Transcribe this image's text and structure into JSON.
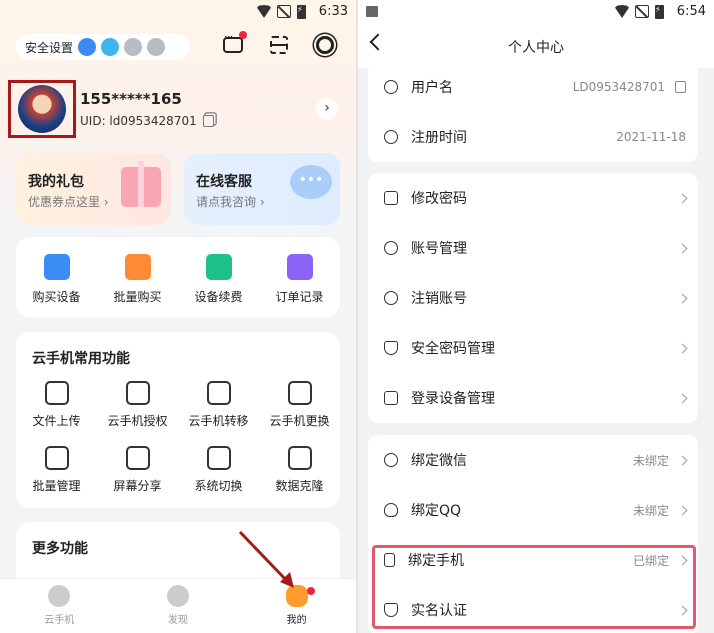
{
  "left": {
    "status": {
      "time": "6:33"
    },
    "security": {
      "label": "安全设置"
    },
    "user": {
      "phone": "155*****165",
      "uid": "UID: ld0953428701"
    },
    "cards": [
      {
        "title": "我的礼包",
        "sub": "优惠券点这里 ›"
      },
      {
        "title": "在线客服",
        "sub": "请点我咨询 ›"
      }
    ],
    "quick": [
      {
        "label": "购买设备",
        "color": "#3c8cf5"
      },
      {
        "label": "批量购买",
        "color": "#ff8a34"
      },
      {
        "label": "设备续费",
        "color": "#1ec18a"
      },
      {
        "label": "订单记录",
        "color": "#8b64f5"
      }
    ],
    "common": {
      "title": "云手机常用功能",
      "items": [
        "文件上传",
        "云手机授权",
        "云手机转移",
        "云手机更换",
        "批量管理",
        "屏幕分享",
        "系统切换",
        "数据克隆"
      ]
    },
    "more": {
      "title": "更多功能"
    },
    "nav": [
      {
        "label": "云手机",
        "icon": "cloud-phone-icon"
      },
      {
        "label": "发现",
        "icon": "discover-icon"
      },
      {
        "label": "我的",
        "icon": "mine-icon"
      }
    ]
  },
  "right": {
    "status": {
      "time": "6:54"
    },
    "title": "个人中心",
    "group1": [
      {
        "label": "用户名",
        "value": "LD0953428701"
      },
      {
        "label": "注册时间",
        "value": "2021-11-18"
      }
    ],
    "group2": [
      {
        "label": "修改密码"
      },
      {
        "label": "账号管理"
      },
      {
        "label": "注销账号"
      },
      {
        "label": "安全密码管理"
      },
      {
        "label": "登录设备管理"
      }
    ],
    "group3": [
      {
        "label": "绑定微信",
        "value": "未绑定"
      },
      {
        "label": "绑定QQ",
        "value": "未绑定"
      },
      {
        "label": "绑定手机",
        "value": "已绑定"
      },
      {
        "label": "实名认证",
        "value": ""
      }
    ]
  }
}
